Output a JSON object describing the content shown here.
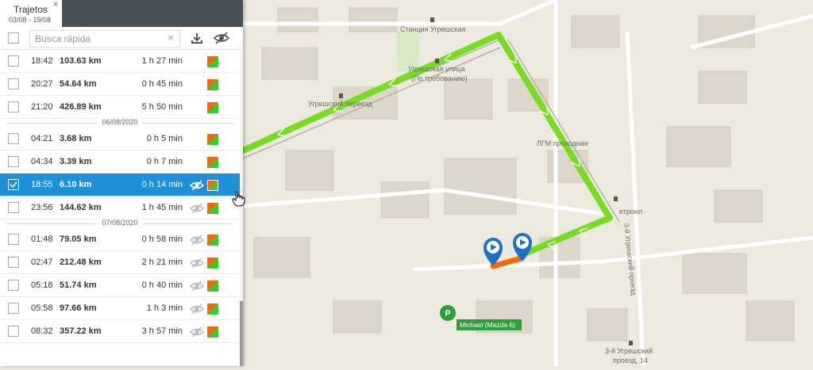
{
  "panel": {
    "tab_title": "Trajetos",
    "tab_range": "03/08 - 19/08",
    "tab_close": "×",
    "search_placeholder": "Busca rápida",
    "search_clear": "×"
  },
  "trips": [
    {
      "time": "18:42",
      "distance": "103.63 km",
      "duration": "1 h 27 min",
      "selected": false,
      "eye": false
    },
    {
      "time": "20:27",
      "distance": "54.64 km",
      "duration": "0 h 45 min",
      "selected": false,
      "eye": false
    },
    {
      "time": "21:20",
      "distance": "426.89 km",
      "duration": "5 h 50 min",
      "selected": false,
      "eye": false
    },
    {
      "date": "06/08/2020"
    },
    {
      "time": "04:21",
      "distance": "3.68 km",
      "duration": "0 h 5 min",
      "selected": false,
      "eye": false
    },
    {
      "time": "04:34",
      "distance": "3.39 km",
      "duration": "0 h 7 min",
      "selected": false,
      "eye": false
    },
    {
      "time": "18:55",
      "distance": "6.10 km",
      "duration": "0 h 14 min",
      "selected": true,
      "eye": true
    },
    {
      "time": "23:56",
      "distance": "144.62 km",
      "duration": "1 h 45 min",
      "selected": false,
      "eye": true
    },
    {
      "date": "07/08/2020"
    },
    {
      "time": "01:48",
      "distance": "79.05 km",
      "duration": "0 h 58 min",
      "selected": false,
      "eye": true
    },
    {
      "time": "02:47",
      "distance": "212.48 km",
      "duration": "2 h 21 min",
      "selected": false,
      "eye": true
    },
    {
      "time": "05:18",
      "distance": "51.74 km",
      "duration": "0 h 40 min",
      "selected": false,
      "eye": true
    },
    {
      "time": "05:58",
      "distance": "97.66 km",
      "duration": "1 h 3 min",
      "selected": false,
      "eye": true
    },
    {
      "time": "08:32",
      "distance": "357.22 km",
      "duration": "3 h 57 min",
      "selected": false,
      "eye": true
    }
  ],
  "map": {
    "labels": {
      "station": "Станция Угрешская",
      "street_stop_1": "Угрешская улица",
      "street_stop_2": "(По требованию)",
      "crossing": "Угрешский переезд",
      "lgm": "ЛГМ проходная",
      "petrol": "етроил",
      "proezd": "3-й Угрешский проезд",
      "addr_1": "3-й Угрешский",
      "addr_2": "проезд, 14"
    },
    "parking_letter": "P",
    "unit_label": "Michael (Mazda 6)"
  },
  "colors": {
    "accent": "#1f8fda",
    "track_green": "#77dd22",
    "track_orange": "#ff6a00",
    "marker_blue": "#1d73c9",
    "parking_green": "#2e9e3b"
  }
}
